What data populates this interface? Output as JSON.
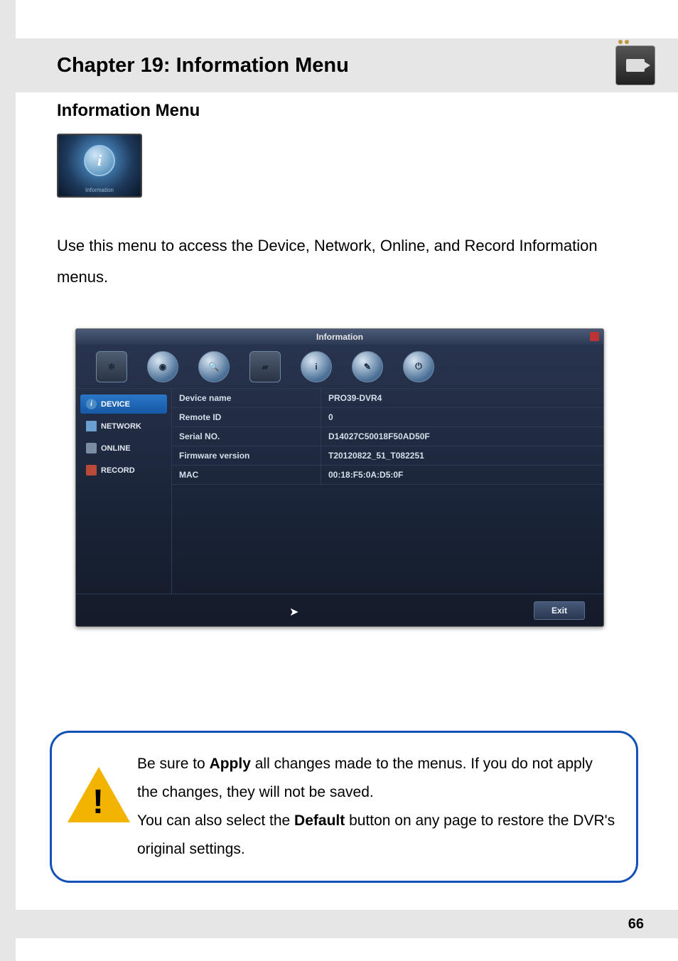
{
  "header": {
    "chapter_title": "Chapter 19: Information Menu"
  },
  "section": {
    "heading": "Information Menu",
    "thumbnail_label": "Information"
  },
  "body_text": "Use this menu to access the Device, Network, Online, and Record Information menus.",
  "screenshot": {
    "window_title": "Information",
    "sidebar": {
      "items": [
        {
          "label": "DEVICE"
        },
        {
          "label": "NETWORK"
        },
        {
          "label": "ONLINE"
        },
        {
          "label": "RECORD"
        }
      ]
    },
    "table": {
      "rows": [
        {
          "label": "Device name",
          "value": "PRO39-DVR4"
        },
        {
          "label": "Remote ID",
          "value": "0"
        },
        {
          "label": "Serial NO.",
          "value": "D14027C50018F50AD50F"
        },
        {
          "label": "Firmware version",
          "value": "T20120822_51_T082251"
        },
        {
          "label": "MAC",
          "value": "00:18:F5:0A:D5:0F"
        }
      ]
    },
    "exit_label": "Exit"
  },
  "callout": {
    "line1_pre": "Be sure to ",
    "line1_bold": "Apply",
    "line1_post": " all changes made to the menus. If you do not apply the changes, they will not be saved.",
    "line2_pre": "You can also select the ",
    "line2_bold": "Default",
    "line2_post": " button on any page to restore the DVR's original settings."
  },
  "footer": {
    "page_number": "66"
  }
}
